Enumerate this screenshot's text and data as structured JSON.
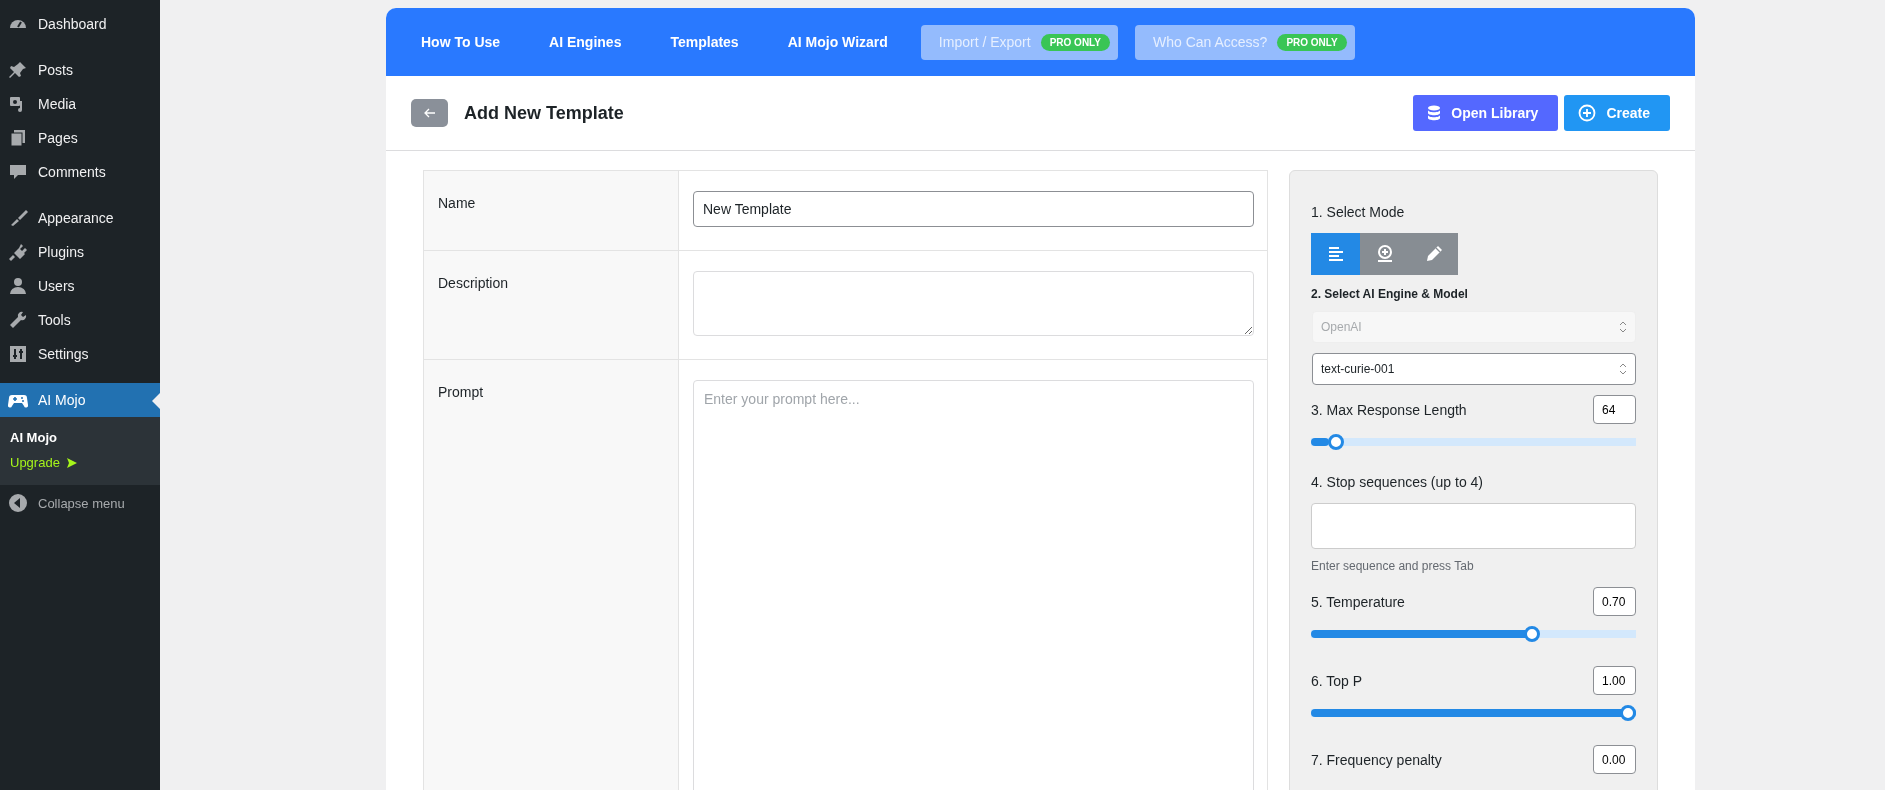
{
  "sidebar": {
    "items": [
      {
        "label": "Dashboard",
        "selected": false
      },
      {
        "label": "Posts",
        "selected": false
      },
      {
        "label": "Media",
        "selected": false
      },
      {
        "label": "Pages",
        "selected": false
      },
      {
        "label": "Comments",
        "selected": false
      },
      {
        "label": "Appearance",
        "selected": false
      },
      {
        "label": "Plugins",
        "selected": false
      },
      {
        "label": "Users",
        "selected": false
      },
      {
        "label": "Tools",
        "selected": false
      },
      {
        "label": "Settings",
        "selected": false
      },
      {
        "label": "AI Mojo",
        "selected": true,
        "children": [
          {
            "label": "AI Mojo",
            "kind": "current"
          },
          {
            "label": "Upgrade",
            "kind": "upgrade"
          }
        ]
      }
    ],
    "collapse": "Collapse menu"
  },
  "tabs": [
    {
      "label": "How To Use",
      "disabled": false
    },
    {
      "label": "AI Engines",
      "disabled": false
    },
    {
      "label": "Templates",
      "disabled": false
    },
    {
      "label": "AI Mojo Wizard",
      "disabled": false
    },
    {
      "label": "Import / Export",
      "disabled": true,
      "badge": "PRO ONLY"
    },
    {
      "label": "Who Can Access?",
      "disabled": true,
      "badge": "PRO ONLY"
    }
  ],
  "header": {
    "title": "Add New Template",
    "buttons": [
      {
        "label": "Open Library",
        "kind": "library"
      },
      {
        "label": "Create",
        "kind": "create"
      }
    ]
  },
  "form": [
    {
      "label": "Name",
      "kind": "input",
      "value": "New Template"
    },
    {
      "label": "Description",
      "kind": "textarea"
    },
    {
      "label": "Prompt",
      "kind": "prompt",
      "placeholder": "Enter your prompt here..."
    }
  ],
  "settings": [
    {
      "kind": "mode",
      "label": "1. Select Mode",
      "modes": [
        {
          "selected": true
        },
        {
          "selected": false
        },
        {
          "selected": false
        }
      ]
    },
    {
      "kind": "engine",
      "label": "2. Select AI Engine & Model",
      "selects": [
        {
          "value": "OpenAI",
          "disabled": true
        },
        {
          "value": "text-curie-001",
          "disabled": false
        }
      ]
    },
    {
      "kind": "slider",
      "label": "3. Max Response Length",
      "value": "64",
      "level": 0.055
    },
    {
      "kind": "tags",
      "label": "4. Stop sequences (up to 4)",
      "hint": "Enter sequence and press Tab"
    },
    {
      "kind": "slider",
      "label": "5. Temperature",
      "value": "0.70",
      "level": 0.69
    },
    {
      "kind": "slider",
      "label": "6. Top P",
      "value": "1.00",
      "level": 1
    },
    {
      "kind": "number",
      "label": "7. Frequency penalty",
      "value": "0.00"
    }
  ]
}
